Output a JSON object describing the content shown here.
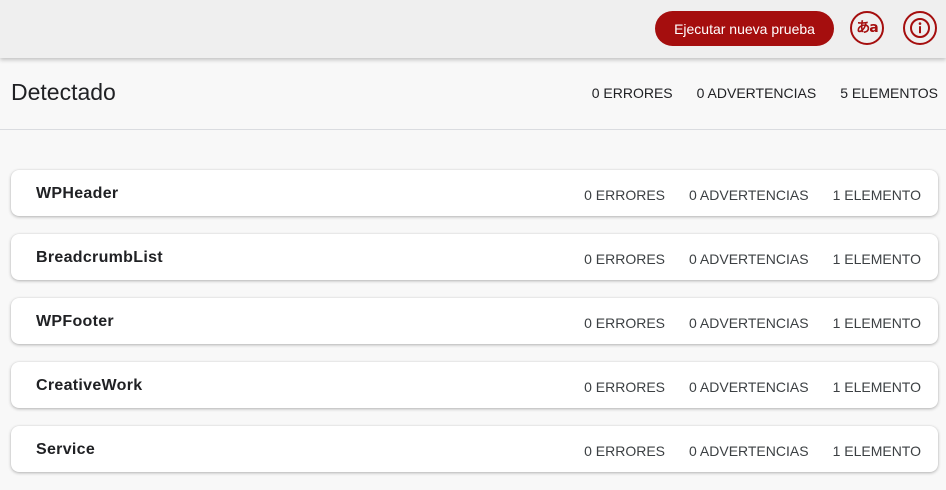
{
  "toolbar": {
    "run_label": "Ejecutar nueva prueba",
    "lang_glyph": "あa",
    "info_glyph": "i"
  },
  "summary": {
    "title": "Detectado",
    "errors": "0 ERRORES",
    "warnings": "0 ADVERTENCIAS",
    "items": "5 ELEMENTOS"
  },
  "types": [
    {
      "name": "WPHeader",
      "errors": "0 ERRORES",
      "warnings": "0 ADVERTENCIAS",
      "items": "1 ELEMENTO"
    },
    {
      "name": "BreadcrumbList",
      "errors": "0 ERRORES",
      "warnings": "0 ADVERTENCIAS",
      "items": "1 ELEMENTO"
    },
    {
      "name": "WPFooter",
      "errors": "0 ERRORES",
      "warnings": "0 ADVERTENCIAS",
      "items": "1 ELEMENTO"
    },
    {
      "name": "CreativeWork",
      "errors": "0 ERRORES",
      "warnings": "0 ADVERTENCIAS",
      "items": "1 ELEMENTO"
    },
    {
      "name": "Service",
      "errors": "0 ERRORES",
      "warnings": "0 ADVERTENCIAS",
      "items": "1 ELEMENTO"
    }
  ],
  "colors": {
    "accent": "#a50e0e",
    "topbar_bg": "#efefef",
    "page_bg": "#f8f8f8",
    "card_bg": "#ffffff"
  },
  "icons": {
    "language": "translate-icon",
    "info": "info-icon"
  }
}
